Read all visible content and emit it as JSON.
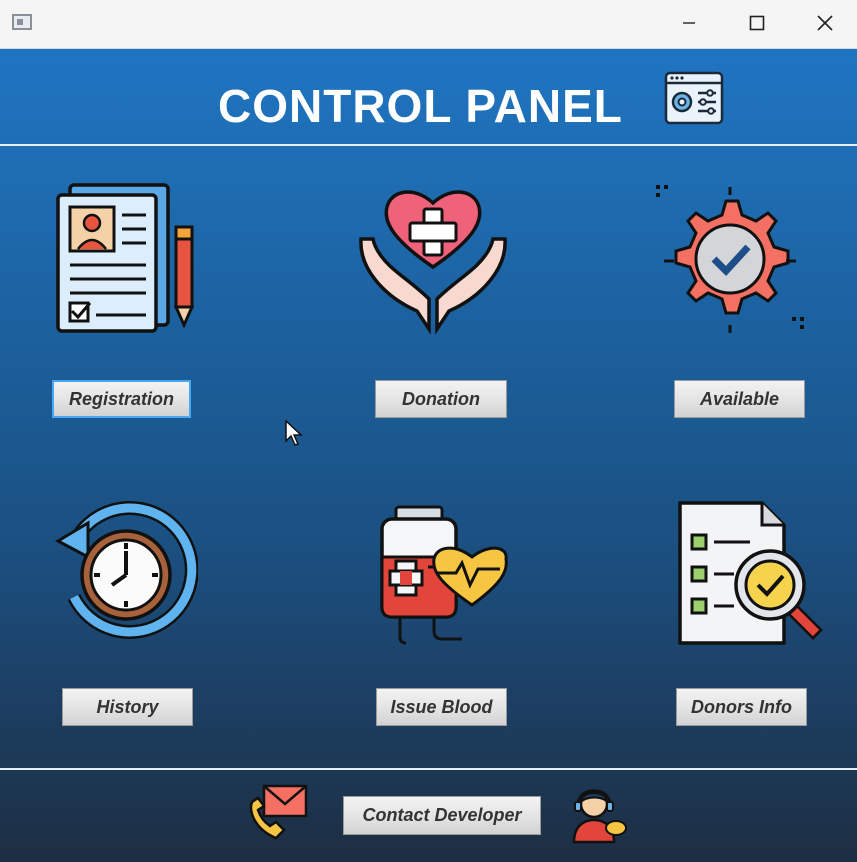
{
  "window": {
    "controls": {
      "minimize_icon": "minimize-icon",
      "maximize_icon": "maximize-icon",
      "close_icon": "close-icon"
    }
  },
  "header": {
    "title": "CONTROL PANEL",
    "icon": "settings-window-icon"
  },
  "tiles": [
    {
      "label": "Registration",
      "icon": "registration-form-icon",
      "focused": true
    },
    {
      "label": "Donation",
      "icon": "donation-heart-hands-icon"
    },
    {
      "label": "Available",
      "icon": "gear-check-icon"
    },
    {
      "label": "History",
      "icon": "history-clock-icon"
    },
    {
      "label": "Issue Blood",
      "icon": "blood-bag-icon"
    },
    {
      "label": "Donors Info",
      "icon": "document-search-icon"
    }
  ],
  "footer": {
    "contact_label": "Contact Developer",
    "left_icon": "phone-mail-icon",
    "right_icon": "support-agent-icon"
  },
  "colors": {
    "panel_top": "#1f74c1",
    "panel_bottom": "#1d2e42",
    "button_focus": "#4aa8f0"
  }
}
